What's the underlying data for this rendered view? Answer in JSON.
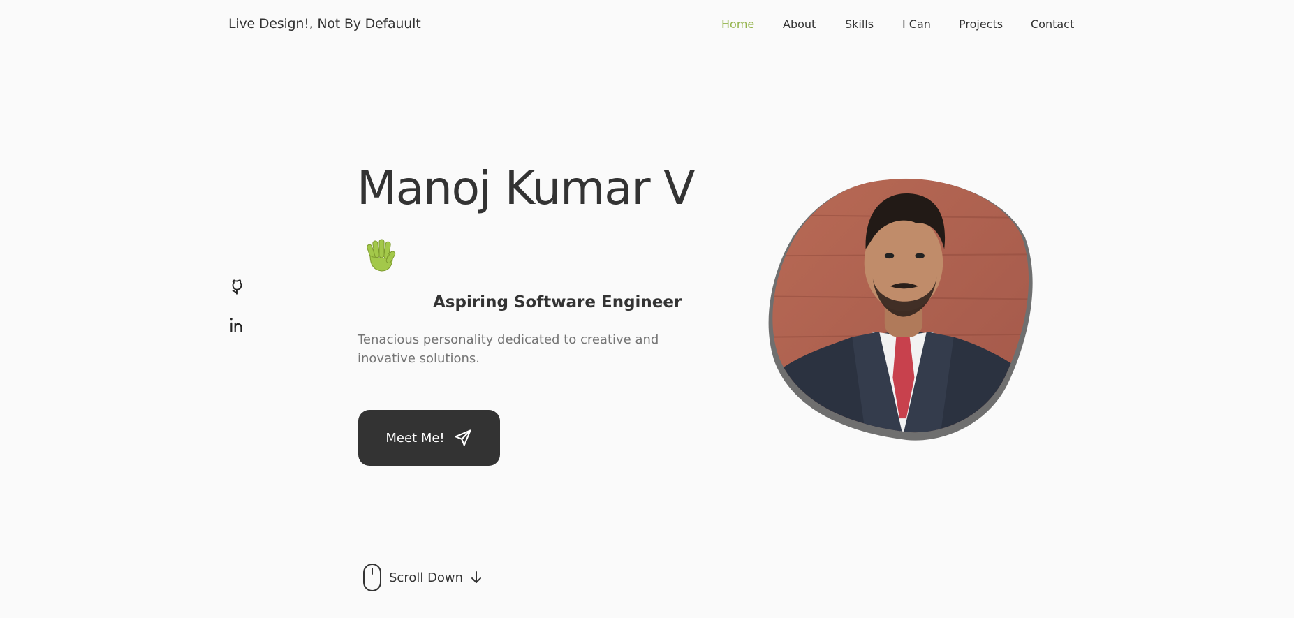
{
  "header": {
    "logo": "Live Design!, Not By Defauult",
    "nav": [
      {
        "label": "Home",
        "active": true
      },
      {
        "label": "About",
        "active": false
      },
      {
        "label": "Skills",
        "active": false
      },
      {
        "label": "I Can",
        "active": false
      },
      {
        "label": "Projects",
        "active": false
      },
      {
        "label": "Contact",
        "active": false
      }
    ]
  },
  "socials": [
    {
      "icon": "github-icon"
    },
    {
      "icon": "linkedin-icon"
    }
  ],
  "hero": {
    "name": "Manoj Kumar V",
    "wave_icon": "waving-hand-icon",
    "subtitle": "Aspiring Software Engineer",
    "description": "Tenacious personality dedicated to creative and inovative solutions.",
    "cta_label": "Meet Me!",
    "cta_icon": "send-icon"
  },
  "scroll": {
    "label": "Scroll Down",
    "mouse_icon": "mouse-icon",
    "arrow_icon": "arrow-down-icon"
  },
  "colors": {
    "accent": "#93b34a",
    "text": "#333333",
    "muted": "#757575",
    "background": "#fafafa",
    "button": "#333333"
  }
}
